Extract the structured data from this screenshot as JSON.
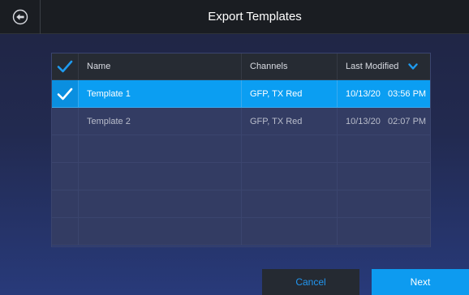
{
  "header": {
    "title": "Export Templates",
    "back_icon": "arrow-left-circle-icon"
  },
  "table": {
    "columns": {
      "select_all_icon": "checkmark-icon",
      "name": "Name",
      "channels": "Channels",
      "last_modified": "Last Modified",
      "sort_icon": "chevron-down-icon"
    },
    "rows": [
      {
        "selected": true,
        "name": "Template 1",
        "channels": "GFP, TX Red",
        "last_modified": "10/13/20   03:56 PM"
      },
      {
        "selected": false,
        "name": "Template 2",
        "channels": "GFP, TX Red",
        "last_modified": "10/13/20   02:07 PM"
      }
    ],
    "empty_rows": 4
  },
  "footer": {
    "cancel_label": "Cancel",
    "next_label": "Next"
  },
  "colors": {
    "accent": "#0b9ef2",
    "titlebar": "#1a1d22",
    "row_bg": "#333c63"
  }
}
